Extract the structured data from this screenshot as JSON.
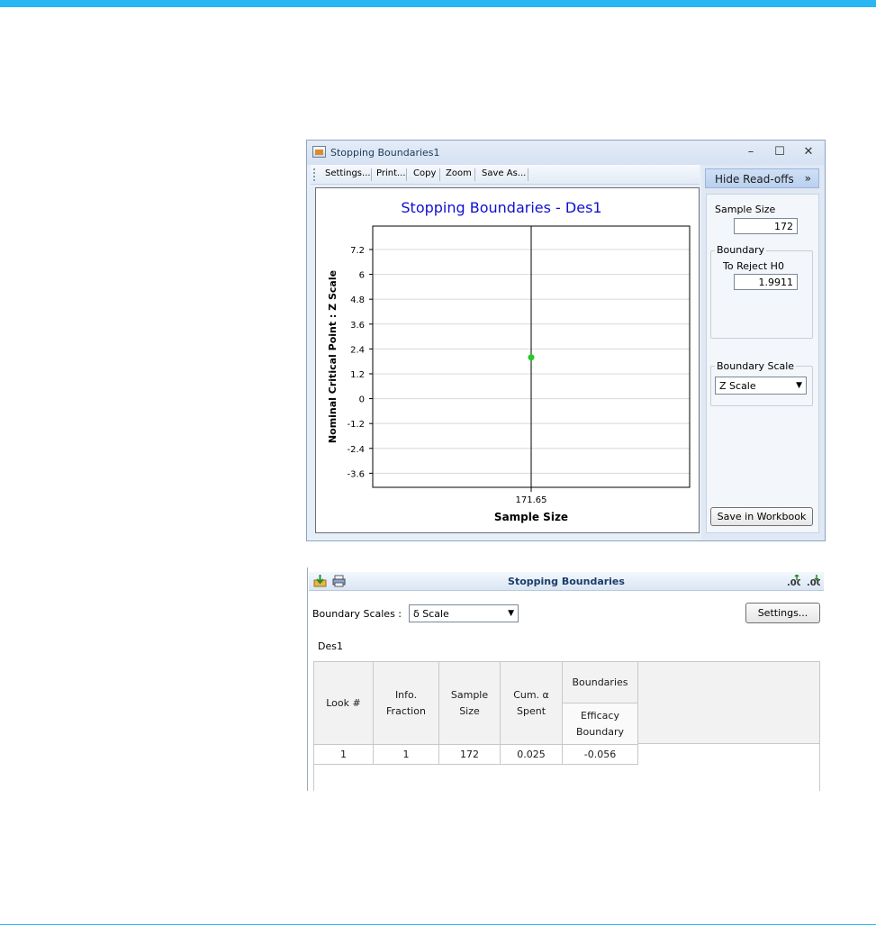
{
  "window": {
    "title": "Stopping Boundaries1",
    "controls": {
      "minimize": "–",
      "maximize": "☐",
      "close": "✕"
    }
  },
  "toolbar": {
    "settings": "Settings...",
    "print": "Print...",
    "copy": "Copy",
    "zoom": "Zoom",
    "save_as": "Save As..."
  },
  "chart_data": {
    "type": "scatter",
    "title": "Stopping Boundaries - Des1",
    "xlabel": "Sample Size",
    "ylabel": "Nominal Critical Point : Z Scale",
    "xlim": [
      171.15,
      172.15
    ],
    "ylim": [
      -4.28,
      8.33
    ],
    "x_ticks": [
      171.65
    ],
    "x_tick_labels": [
      "171.65"
    ],
    "y_ticks": [
      7.2,
      6,
      4.8,
      3.6,
      2.4,
      1.2,
      0,
      -1.2,
      -2.4,
      -3.6
    ],
    "y_tick_labels": [
      "7.2",
      "6",
      "4.8",
      "3.6",
      "2.4",
      "1.2",
      "0",
      "-1.2",
      "-2.4",
      "-3.6"
    ],
    "grid": true,
    "series": [
      {
        "x": [
          171.65
        ],
        "y": [
          1.9911
        ],
        "color": "#22cc22"
      }
    ],
    "vertical_line_x": 171.65,
    "title_color": "#1010d0"
  },
  "readoffs": {
    "hide_label": "Hide Read-offs",
    "hide_arrow": "»",
    "sample_size_label": "Sample Size",
    "sample_size_value": "172",
    "boundary_group": "Boundary",
    "reject_label": "To Reject H0",
    "reject_value": "1.9911",
    "scale_group": "Boundary Scale",
    "scale_value": "Z Scale",
    "save_label": "Save in Workbook"
  },
  "output": {
    "title": "Stopping Boundaries",
    "scales_label": "Boundary Scales :",
    "scales_value": "δ Scale",
    "settings_label": "Settings...",
    "design_label": "Des1",
    "columns": {
      "look": "Look #",
      "info": [
        "Info.",
        "Fraction"
      ],
      "sample": [
        "Sample",
        "Size"
      ],
      "cum": [
        "Cum. α",
        "Spent"
      ],
      "boundaries": "Boundaries",
      "efficacy": [
        "Efficacy",
        "Boundary"
      ]
    },
    "rows": [
      {
        "look": "1",
        "info": "1",
        "sample": "172",
        "cum": "0.025",
        "efficacy": "-0.056"
      }
    ]
  }
}
